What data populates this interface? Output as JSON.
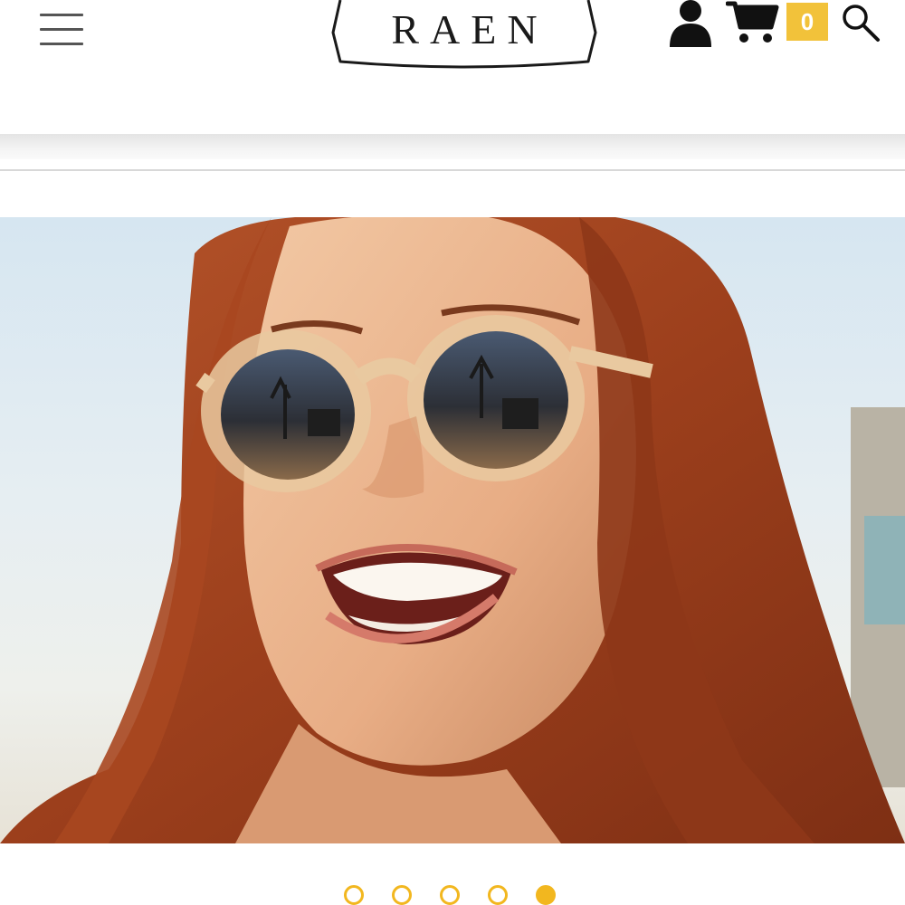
{
  "header": {
    "logo_text": "RAEN",
    "cart_count": "0"
  },
  "icons": {
    "menu": "hamburger-menu-icon",
    "account": "person-icon",
    "cart": "shopping-cart-icon",
    "search": "magnifier-icon"
  },
  "colors": {
    "accent": "#f2b71f",
    "badge": "#f2c23a",
    "text": "#1a1a1a"
  },
  "hero": {
    "image": "woman-smiling-in-sunglasses-photo"
  },
  "carousel": {
    "slide_count": 5,
    "active_index": 4
  }
}
